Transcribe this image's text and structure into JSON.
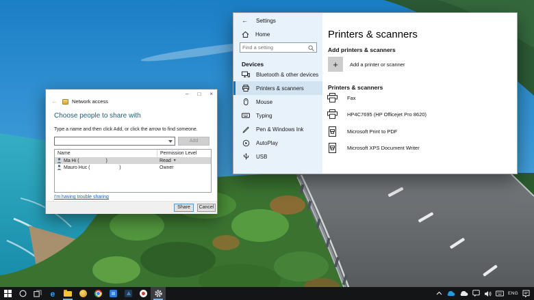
{
  "colors": {
    "accent": "#0078d7",
    "taskbar": "#141517",
    "sidebar": "#e8f2fa"
  },
  "settings_window": {
    "titlebar": {
      "back_glyph": "←",
      "title": "Settings",
      "minimize_glyph": "–",
      "maximize_glyph": "□",
      "close_glyph": "×"
    },
    "sidebar": {
      "home_label": "Home",
      "search": {
        "placeholder": "Find a setting"
      },
      "section_label": "Devices",
      "items": [
        {
          "label": "Bluetooth & other devices",
          "selected": false
        },
        {
          "label": "Printers & scanners",
          "selected": true
        },
        {
          "label": "Mouse",
          "selected": false
        },
        {
          "label": "Typing",
          "selected": false
        },
        {
          "label": "Pen & Windows Ink",
          "selected": false
        },
        {
          "label": "AutoPlay",
          "selected": false
        },
        {
          "label": "USB",
          "selected": false
        }
      ]
    },
    "content": {
      "page_title": "Printers & scanners",
      "add_section_title": "Add printers & scanners",
      "add_button_glyph": "+",
      "add_button_label": "Add a printer or scanner",
      "list_section_title": "Printers & scanners",
      "printers": [
        {
          "name": "Fax",
          "icon": "printer-icon"
        },
        {
          "name": "HP4C7695 (HP Officejet Pro 8620)",
          "icon": "printer-icon"
        },
        {
          "name": "Microsoft Print to PDF",
          "icon": "print-to-file-icon"
        },
        {
          "name": "Microsoft XPS Document Writer",
          "icon": "print-to-file-icon"
        }
      ]
    }
  },
  "network_dialog": {
    "titlebar": {
      "back_glyph": "←",
      "title": "Network access",
      "minimize_glyph": "–",
      "maximize_glyph": "□",
      "close_glyph": "×"
    },
    "heading": "Choose people to share with",
    "instruction": "Type a name and then click Add, or click the arrow to find someone.",
    "combo_value": "",
    "add_button_label": "Add",
    "table": {
      "columns": [
        "Name",
        "Permission Level"
      ],
      "rows": [
        {
          "name": "Ma Hi (                    )",
          "permission": "Read",
          "dropdown_glyph": "▼",
          "selected": true
        },
        {
          "name": "Mauro Huc (                      )",
          "permission": "Owner",
          "dropdown_glyph": "",
          "selected": false
        }
      ]
    },
    "trouble_link": "I'm having trouble sharing",
    "share_button_label": "Share",
    "cancel_button_label": "Cancel"
  },
  "taskbar": {
    "edge_glyph": "e",
    "language_indicator": "ENG",
    "left_icons": [
      "start",
      "cortana",
      "task-view",
      "edge",
      "file-explorer",
      "app-yellow-disc",
      "chrome",
      "app-blue",
      "app-dark",
      "app-circle",
      "settings"
    ],
    "tray_icons": [
      "tray-expand",
      "onedrive-cloud",
      "cloud",
      "feedback-hub",
      "volume",
      "touch-keyboard",
      "language",
      "action-center"
    ]
  }
}
